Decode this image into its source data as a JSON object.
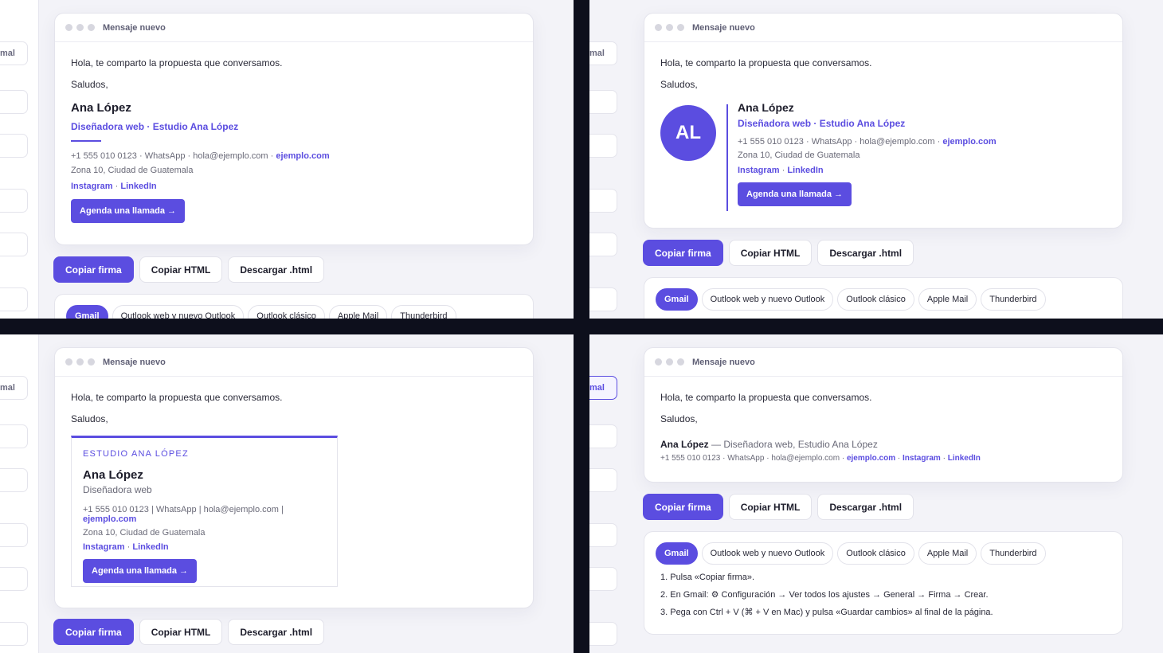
{
  "window_title": "Mensaje nuevo",
  "greeting": "Hola, te comparto la propuesta que conversamos.",
  "closing": "Saludos,",
  "signature": {
    "name": "Ana López",
    "role_studio": "Diseñadora web · Estudio Ana López",
    "role": "Diseñadora web",
    "studio_caps": "ESTUDIO ANA LÓPEZ",
    "initials": "AL",
    "phone": "+1 555 010 0123",
    "whatsapp": "WhatsApp",
    "email": "hola@ejemplo.com",
    "website": "ejemplo.com",
    "address": "Zona 10, Ciudad de Guatemala",
    "instagram": "Instagram",
    "linkedin": "LinkedIn",
    "cta": "Agenda una llamada →",
    "inline_role": "— Diseñadora web, Estudio Ana López",
    "sep_dot": "·",
    "sep_bar": "|"
  },
  "sidebar": {
    "chip_label": "mal"
  },
  "actions": {
    "copy_signature": "Copiar firma",
    "copy_html": "Copiar HTML",
    "download": "Descargar .html"
  },
  "clients": {
    "tabs": [
      "Gmail",
      "Outlook web y nuevo Outlook",
      "Outlook clásico",
      "Apple Mail",
      "Thunderbird"
    ],
    "steps": [
      "1. Pulsa «Copiar firma».",
      "2. En Gmail: ⚙ Configuración → Ver todos los ajustes → General → Firma → Crear.",
      "3. Pega con Ctrl + V (⌘ + V en Mac) y pulsa «Guardar cambios» al final de la página."
    ]
  },
  "colors": {
    "accent": "#5b4de0",
    "divider": "#0d0f1c",
    "background": "#f3f3f8"
  }
}
